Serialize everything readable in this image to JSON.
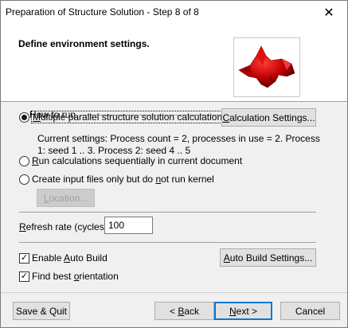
{
  "window": {
    "title": "Preparation of Structure Solution - Step 8 of 8",
    "close_glyph": "✕"
  },
  "header": {
    "title": "Define environment settings.",
    "image_icon": "structure-surface-image"
  },
  "how_to_run": {
    "group_label": "How to run",
    "option_multiple": {
      "before": "",
      "key": "M",
      "after": "ultiple parallel structure solution calculations",
      "checked": true
    },
    "calc_settings_button": {
      "key": "C",
      "after": "alculation Settings..."
    },
    "current_settings": "Current settings: Process count = 2, processes in use = 2. Process 1: seed 1 .. 3. Process 2: seed 4 .. 5",
    "option_sequential": {
      "before": "",
      "key": "R",
      "after": "un calculations sequentially in current document",
      "checked": false
    },
    "option_input_only": {
      "before": "Create input files only but do ",
      "key": "n",
      "after": "ot run kernel",
      "checked": false
    },
    "location_button": {
      "key": "L",
      "after": "ocation..."
    }
  },
  "refresh": {
    "label_key": "R",
    "label_after": "efresh rate (cycles):",
    "value": "100"
  },
  "auto_build": {
    "before": "Enable ",
    "key": "A",
    "after": "uto Build",
    "checked": true
  },
  "auto_build_settings_button": {
    "key": "A",
    "after": "uto Build Settings..."
  },
  "best_orientation": {
    "before": "Find best ",
    "key": "o",
    "after": "rientation",
    "checked": true
  },
  "footer": {
    "save_quit": "Save & Quit",
    "back_key": "B",
    "back_before": "< ",
    "back_after": "ack",
    "next_key": "N",
    "next_after": "ext >",
    "cancel": "Cancel"
  }
}
